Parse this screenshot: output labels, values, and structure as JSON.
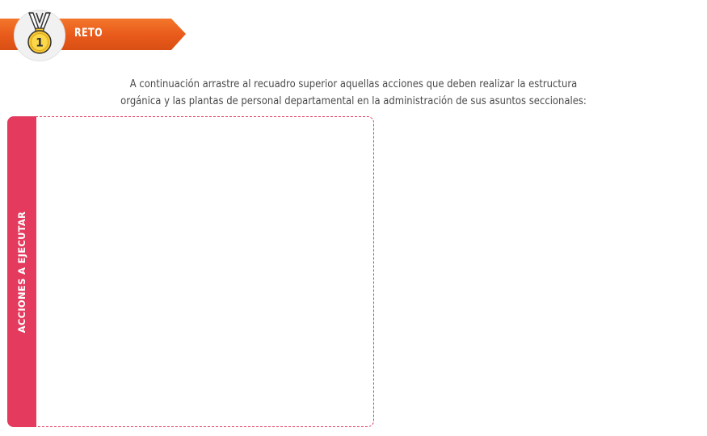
{
  "header": {
    "badge_number": "1",
    "title": "RETO",
    "medal_icon": "gold-medal-icon"
  },
  "instructions": {
    "line1": "A continuación arrastre al recuadro superior aquellas acciones que deben realizar la estructura",
    "line2": "orgánica y las plantas de personal departamental en la administración de sus asuntos seccionales:"
  },
  "drop_zone": {
    "label": "ACCIONES A EJECUTAR"
  },
  "colors": {
    "banner_orange": "#e8561a",
    "accent_pink": "#e33a5d",
    "medal_gold": "#f6c531",
    "text_gray": "#4a4a4a"
  }
}
